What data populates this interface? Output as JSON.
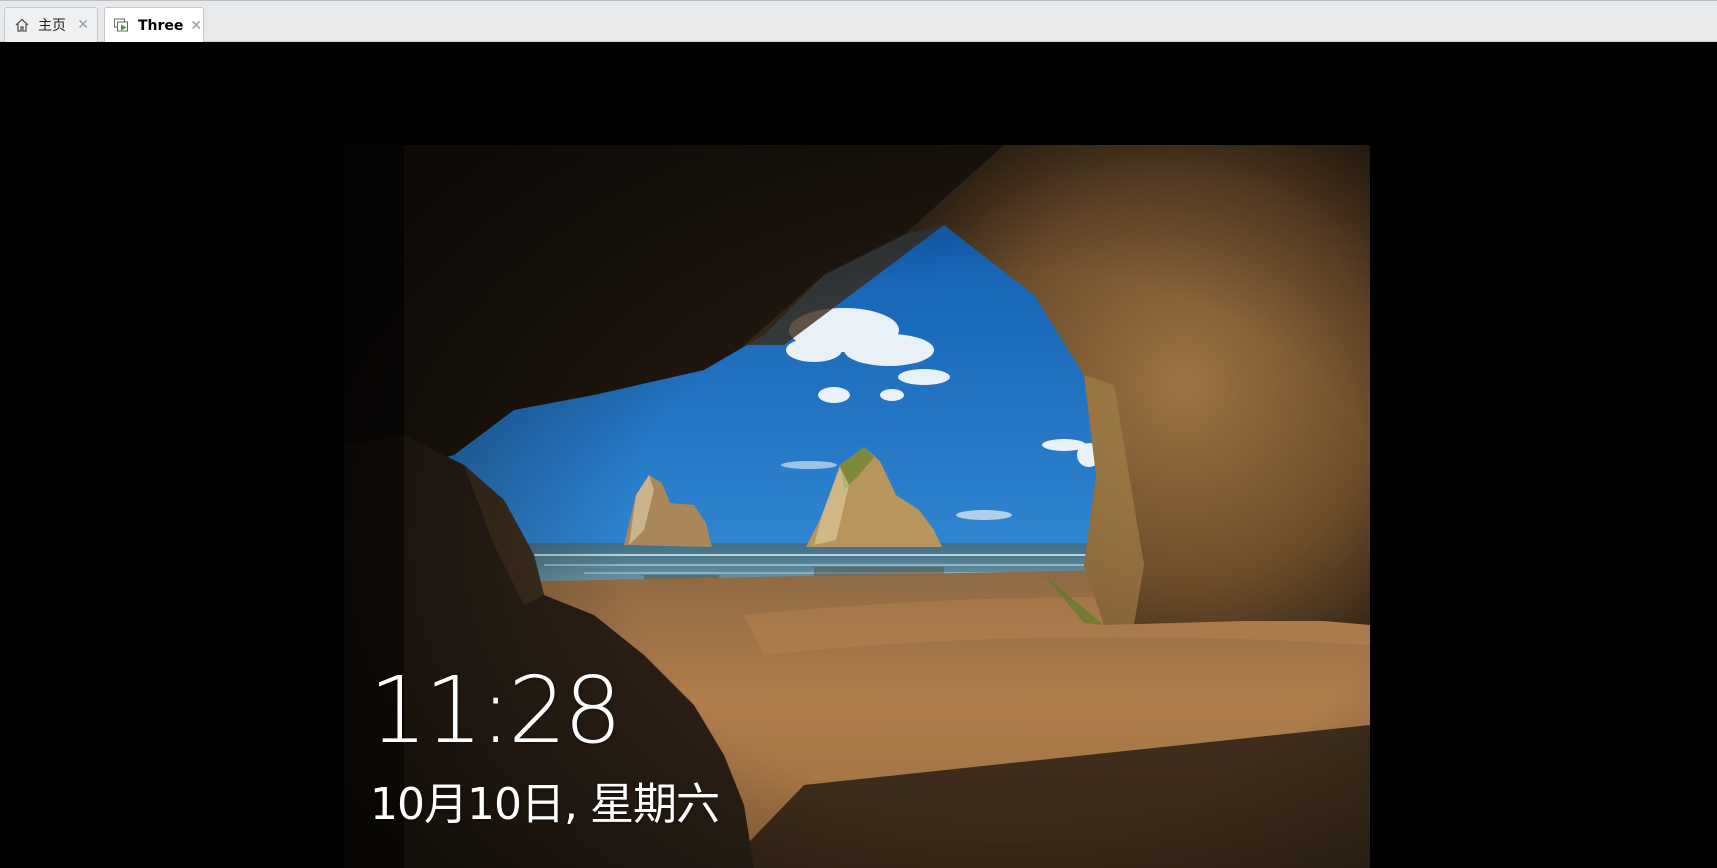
{
  "tabs": [
    {
      "label": "主页",
      "icon": "home-icon",
      "active": false
    },
    {
      "label": "Three",
      "icon": "vm-icon",
      "active": true
    }
  ],
  "lockscreen": {
    "time": "11:28",
    "date": "10月10日, 星期六",
    "wallpaper": "cave-beach-wallpaper"
  },
  "colors": {
    "tabbar_bg": "#e8e9eb",
    "tab_active_bg": "#ffffff",
    "vm_icon_accent": "#3aa02c",
    "sky_top": "#0e5bb0",
    "sky_bottom": "#6fb2e2",
    "sand": "#a8794a",
    "rock": "#7a5a33"
  }
}
